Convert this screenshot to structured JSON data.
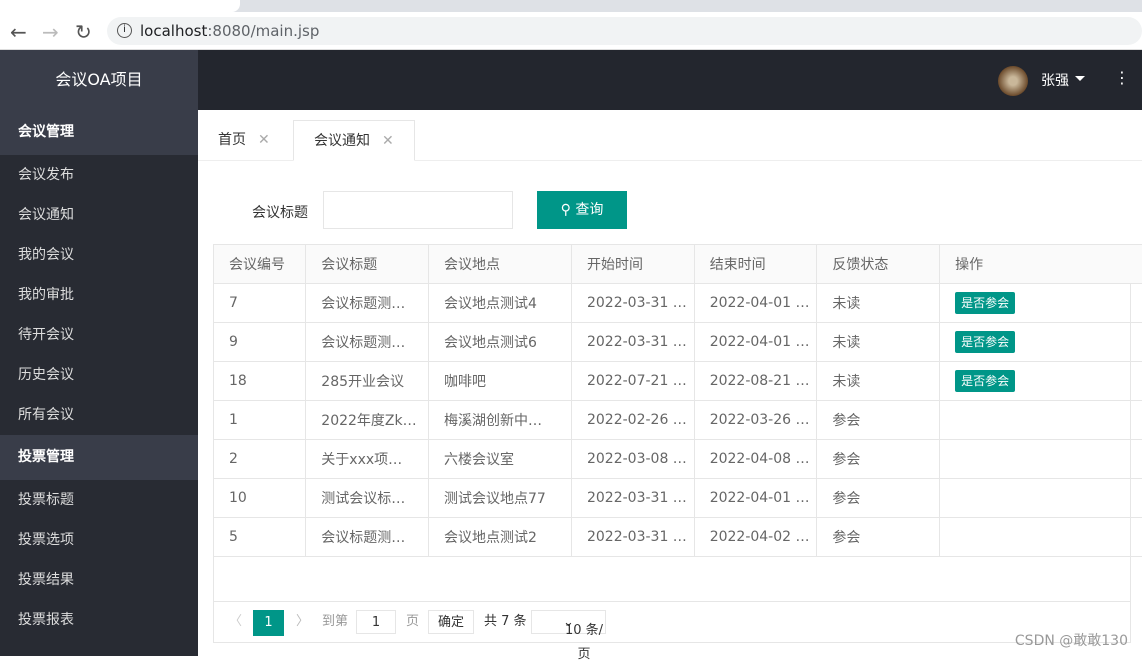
{
  "browser": {
    "url_host": "localhost",
    "url_rest": ":8080/main.jsp"
  },
  "sidebar": {
    "title": "会议OA项目",
    "sections": [
      {
        "label": "会议管理",
        "items": [
          "会议发布",
          "会议通知",
          "我的会议",
          "我的审批",
          "待开会议",
          "历史会议",
          "所有会议"
        ]
      },
      {
        "label": "投票管理",
        "items": [
          "投票标题",
          "投票选项",
          "投票结果",
          "投票报表"
        ]
      }
    ]
  },
  "header": {
    "user": "张强",
    "more": "⋮"
  },
  "tabs": [
    {
      "label": "首页"
    },
    {
      "label": "会议通知",
      "active": true
    }
  ],
  "search": {
    "label": "会议标题",
    "value": "",
    "button": "查询"
  },
  "table": {
    "columns": [
      "会议编号",
      "会议标题",
      "会议地点",
      "开始时间",
      "结束时间",
      "反馈状态",
      "操作"
    ],
    "rows": [
      [
        "7",
        "会议标题测…",
        "会议地点测试4",
        "2022-03-31 …",
        "2022-04-01 …",
        "未读",
        "是否参会"
      ],
      [
        "9",
        "会议标题测…",
        "会议地点测试6",
        "2022-03-31 …",
        "2022-04-01 …",
        "未读",
        "是否参会"
      ],
      [
        "18",
        "285开业会议",
        "咖啡吧",
        "2022-07-21 …",
        "2022-08-21 …",
        "未读",
        "是否参会"
      ],
      [
        "1",
        "2022年度Zk…",
        "梅溪湖创新中…",
        "2022-02-26 …",
        "2022-03-26 …",
        "参会",
        ""
      ],
      [
        "2",
        "关于xxx项…",
        "六楼会议室",
        "2022-03-08 …",
        "2022-04-08 …",
        "参会",
        ""
      ],
      [
        "10",
        "测试会议标…",
        "测试会议地点77",
        "2022-03-31 …",
        "2022-04-01 …",
        "参会",
        ""
      ],
      [
        "5",
        "会议标题测…",
        "会议地点测试2",
        "2022-03-31 …",
        "2022-04-02 …",
        "参会",
        ""
      ]
    ]
  },
  "pager": {
    "current": "1",
    "goto_label": "到第",
    "goto_value": "1",
    "page_label": "页",
    "confirm": "确定",
    "total": "共 7 条",
    "page_size": "10 条/页"
  },
  "watermark": "CSDN @敢敢130",
  "colors": {
    "accent": "#009688",
    "sidebar": "#282b33",
    "header": "#23262e"
  }
}
